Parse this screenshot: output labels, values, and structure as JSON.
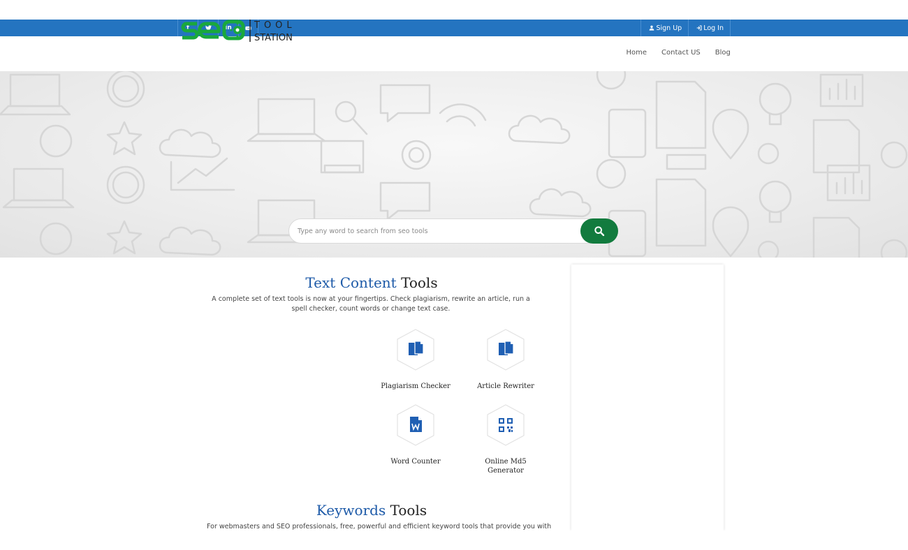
{
  "topbar": {
    "social": [
      {
        "icon": "facebook-icon",
        "glyph": "f"
      },
      {
        "icon": "twitter-icon",
        "glyph": "t"
      },
      {
        "icon": "linkedin-icon",
        "glyph": "in"
      },
      {
        "icon": "youtube-icon",
        "glyph": "▶"
      }
    ],
    "signup_label": "Sign Up",
    "login_label": "Log In"
  },
  "logo": {
    "text_main": "seo",
    "text_tool": "TOOL",
    "text_station": "STATION"
  },
  "nav": {
    "items": [
      "Home",
      "Contact US",
      "Blog"
    ]
  },
  "search": {
    "placeholder": "Type any word to search from seo tools"
  },
  "sections": [
    {
      "title_blue": "Text Content",
      "title_dark": "Tools",
      "description": "A complete set of text tools is now at your fingertips. Check plagiarism, rewrite an article, run a spell checker, count words or change text case.",
      "tools": [
        {
          "name": "Plagiarism Checker",
          "icon": "copy-documents-icon"
        },
        {
          "name": "Article Rewriter",
          "icon": "copy-documents-icon"
        },
        {
          "name": "Word Counter",
          "icon": "word-document-icon"
        },
        {
          "name": "Online Md5 Generator",
          "icon": "qr-code-icon"
        }
      ]
    },
    {
      "title_blue": "Keywords",
      "title_dark": "Tools",
      "description": "For webmasters and SEO professionals, free, powerful and efficient keyword tools that provide you with"
    }
  ],
  "colors": {
    "topbar": "#2474c0",
    "accent_green": "#127b3e",
    "logo_green": "#1aa83c",
    "title_blue": "#1d5aa8",
    "icon_blue": "#1f5fb3"
  }
}
